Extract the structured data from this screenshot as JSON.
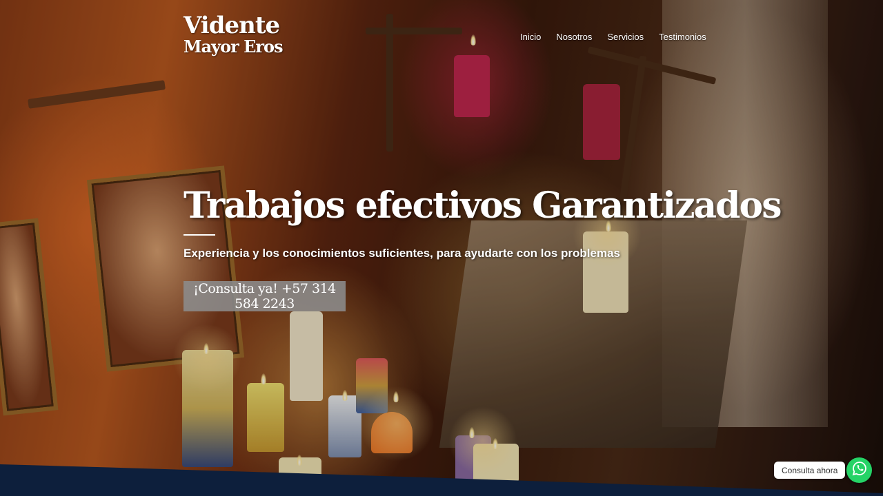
{
  "brand": {
    "line1": "Vidente",
    "line2": "Mayor Eros"
  },
  "nav": {
    "items": [
      {
        "label": "Inicio"
      },
      {
        "label": "Nosotros"
      },
      {
        "label": "Servicios"
      },
      {
        "label": "Testimonios"
      }
    ]
  },
  "hero": {
    "title": "Trabajos efectivos Garantizados",
    "subtitle": "Experiencia y los conocimientos suficientes, para ayudarte con los problemas",
    "cta_label": "¡Consulta ya! +57 314 584 2243"
  },
  "whatsapp": {
    "label": "Consulta ahora",
    "icon": "whatsapp-icon",
    "color": "#25d366"
  },
  "colors": {
    "footer_band": "#0d1f3c",
    "cta_bg": "#8c8c8c",
    "text": "#ffffff"
  }
}
